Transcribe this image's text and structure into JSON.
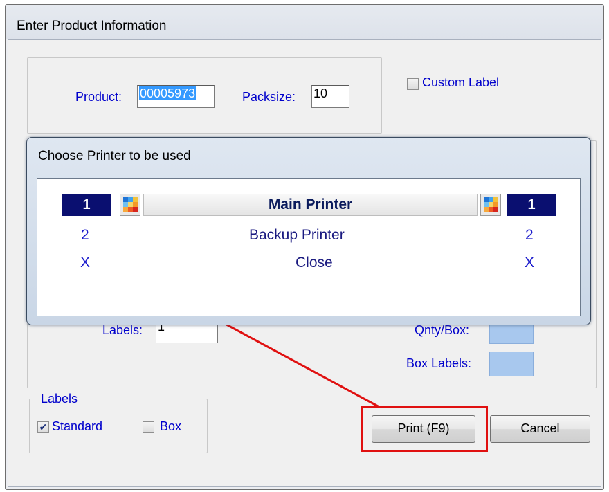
{
  "dialog": {
    "title": "Enter Product Information",
    "product_label": "Product:",
    "product_value": "00005973",
    "packsize_label": "Packsize:",
    "packsize_value": "10",
    "custom_label": "Custom Label",
    "custom_label_checked": false,
    "labels_label": "Labels:",
    "labels_value": "1",
    "qty_box_label": "Qnty/Box:",
    "box_labels_label": "Box Labels:",
    "labels_group_title": "Labels",
    "standard_label": "Standard",
    "standard_checked": true,
    "box_label": "Box",
    "box_checked": false,
    "print_button": "Print (F9)",
    "cancel_button": "Cancel"
  },
  "printer_popup": {
    "title": "Choose Printer to be used",
    "options": [
      {
        "key": "1",
        "label": "Main Printer",
        "selected": true
      },
      {
        "key": "2",
        "label": "Backup Printer",
        "selected": false
      },
      {
        "key": "X",
        "label": "Close",
        "selected": false
      }
    ]
  },
  "colors": {
    "highlight": "#e01010",
    "selected_key_bg": "#0a0f70",
    "label_blue": "#0000cc"
  }
}
